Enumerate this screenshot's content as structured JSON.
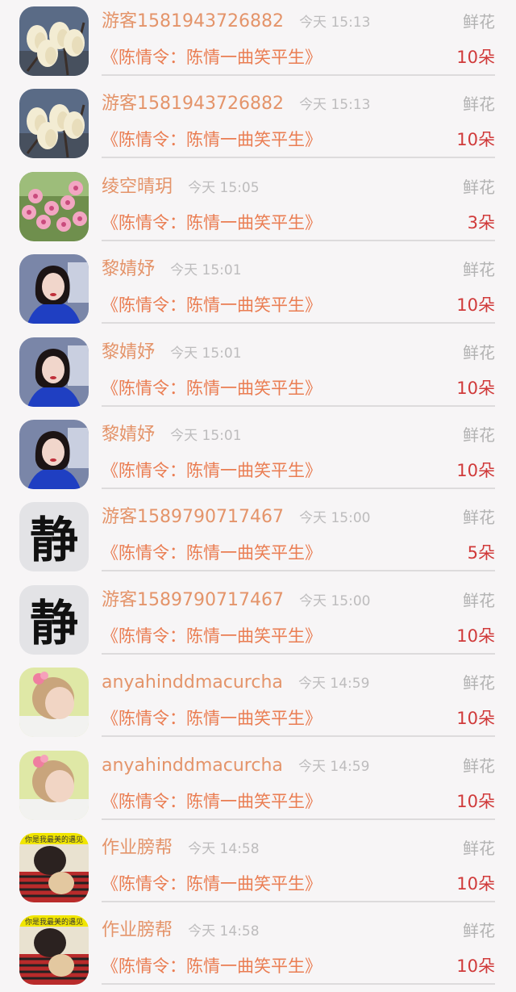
{
  "gift_label": "鲜花",
  "rows": [
    {
      "name": "游客1581943726882",
      "time": "今天 15:13",
      "work": "《陈情令：陈情一曲笑平生》",
      "count": "10朵",
      "avatar": "magnolia"
    },
    {
      "name": "游客1581943726882",
      "time": "今天 15:13",
      "work": "《陈情令：陈情一曲笑平生》",
      "count": "10朵",
      "avatar": "magnolia"
    },
    {
      "name": "绫空晴玥",
      "time": "今天 15:05",
      "work": "《陈情令：陈情一曲笑平生》",
      "count": "3朵",
      "avatar": "pink-blossom"
    },
    {
      "name": "黎婧妤",
      "time": "今天 15:01",
      "work": "《陈情令：陈情一曲笑平生》",
      "count": "10朵",
      "avatar": "woman-blue"
    },
    {
      "name": "黎婧妤",
      "time": "今天 15:01",
      "work": "《陈情令：陈情一曲笑平生》",
      "count": "10朵",
      "avatar": "woman-blue"
    },
    {
      "name": "黎婧妤",
      "time": "今天 15:01",
      "work": "《陈情令：陈情一曲笑平生》",
      "count": "10朵",
      "avatar": "woman-blue"
    },
    {
      "name": "游客1589790717467",
      "time": "今天 15:00",
      "work": "《陈情令：陈情一曲笑平生》",
      "count": "5朵",
      "avatar": "calligraphy"
    },
    {
      "name": "游客1589790717467",
      "time": "今天 15:00",
      "work": "《陈情令：陈情一曲笑平生》",
      "count": "10朵",
      "avatar": "calligraphy"
    },
    {
      "name": "anyahinddmacurcha",
      "time": "今天 14:59",
      "work": "《陈情令：陈情一曲笑平生》",
      "count": "10朵",
      "avatar": "girl"
    },
    {
      "name": "anyahinddmacurcha",
      "time": "今天 14:59",
      "work": "《陈情令：陈情一曲笑平生》",
      "count": "10朵",
      "avatar": "girl"
    },
    {
      "name": "作业膀帮",
      "time": "今天 14:58",
      "work": "《陈情令：陈情一曲笑平生》",
      "count": "10朵",
      "avatar": "boy-cat"
    },
    {
      "name": "作业膀帮",
      "time": "今天 14:58",
      "work": "《陈情令：陈情一曲笑平生》",
      "count": "10朵",
      "avatar": "boy-cat"
    }
  ],
  "avatar_text": {
    "calligraphy": "静",
    "boy_banner": "你是我最美的遇见"
  }
}
